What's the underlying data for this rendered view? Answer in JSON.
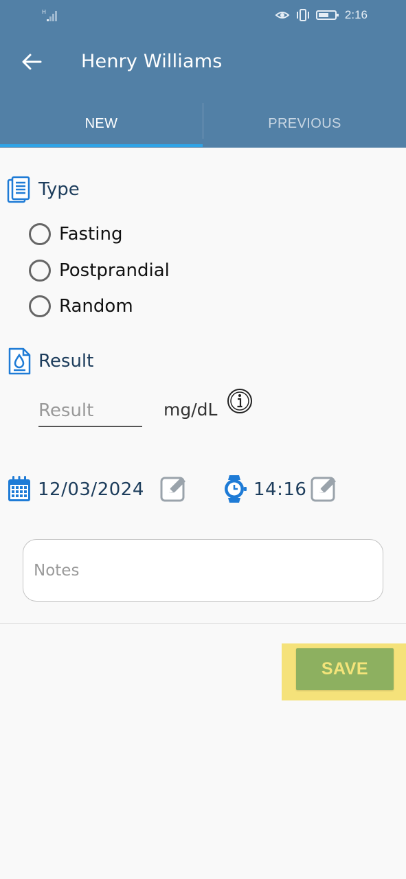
{
  "status_bar": {
    "network": "H",
    "time": "2:16",
    "icons": [
      "signal-icon",
      "eye-icon",
      "vibrate-icon",
      "battery-icon"
    ]
  },
  "header": {
    "title": "Henry Williams",
    "back_icon": "back-arrow-icon",
    "color": "#5280a6"
  },
  "tabs": [
    {
      "label": "NEW",
      "active": true
    },
    {
      "label": "PREVIOUS",
      "active": false
    }
  ],
  "type_section": {
    "label": "Type",
    "icon": "document-list-icon",
    "options": [
      {
        "label": "Fasting",
        "selected": false
      },
      {
        "label": "Postprandial",
        "selected": false
      },
      {
        "label": "Random",
        "selected": false
      }
    ]
  },
  "result_section": {
    "label": "Result",
    "icon": "blood-drop-document-icon",
    "input_placeholder": "Result",
    "input_value": "",
    "unit": "mg/dL",
    "info_icon": "info-icon"
  },
  "datetime": {
    "date": "12/03/2024",
    "time": "14:16",
    "calendar_icon": "calendar-icon",
    "clock_icon": "watch-icon",
    "edit_icon": "edit-icon"
  },
  "notes": {
    "placeholder": "Notes",
    "value": ""
  },
  "actions": {
    "save_label": "SAVE",
    "save_color": "#8db060",
    "highlight_color": "#f5e27a"
  }
}
